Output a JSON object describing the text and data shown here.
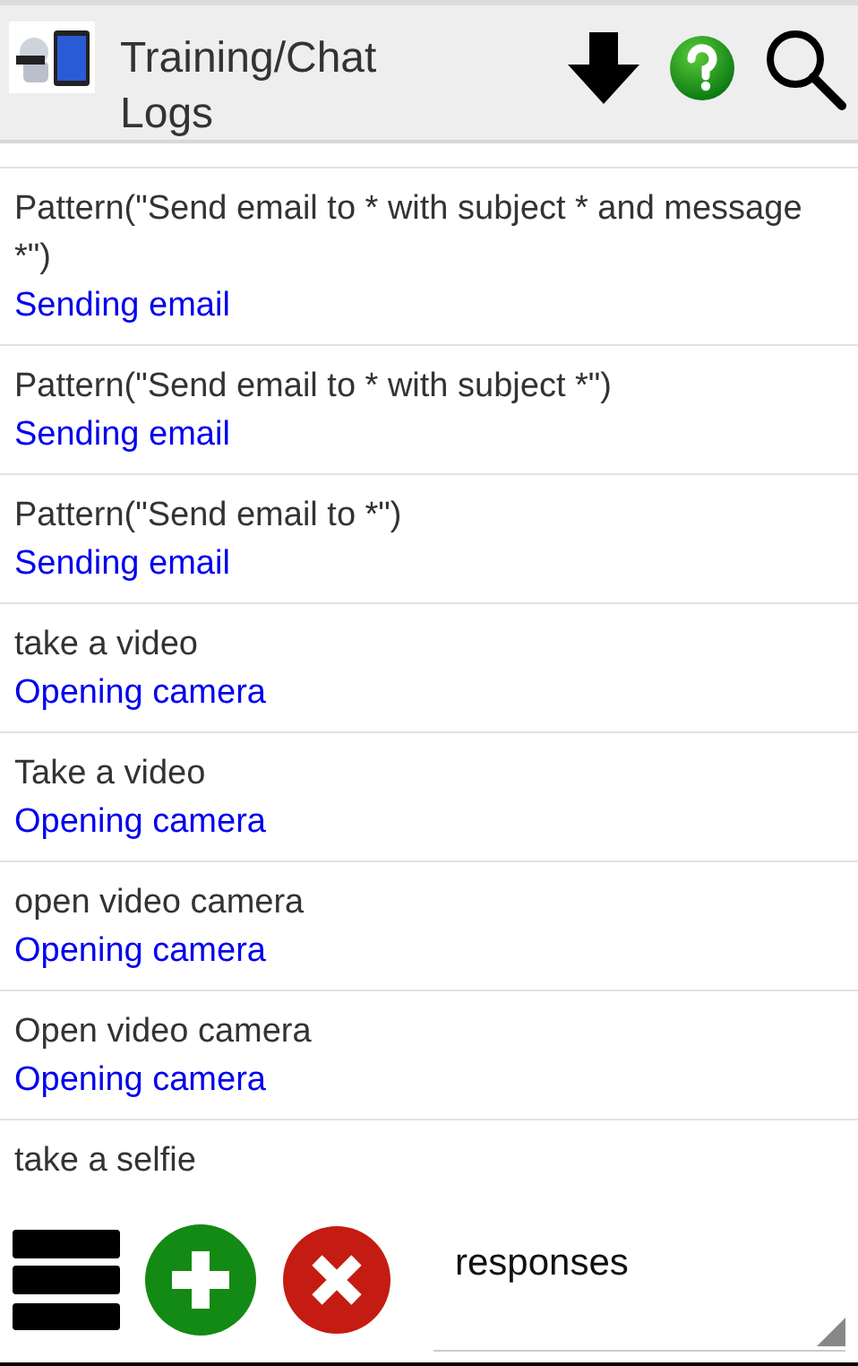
{
  "header": {
    "title": "Training/Chat Logs"
  },
  "logs": [
    {
      "input": "Pattern(\"Send email to * with subject * and message *\")",
      "response": "Sending email"
    },
    {
      "input": "Pattern(\"Send email to * with subject *\")",
      "response": "Sending email"
    },
    {
      "input": "Pattern(\"Send email to *\")",
      "response": "Sending email"
    },
    {
      "input": "take a video",
      "response": "Opening camera"
    },
    {
      "input": "Take a video",
      "response": "Opening camera"
    },
    {
      "input": "open video camera",
      "response": "Opening camera"
    },
    {
      "input": "Open video camera",
      "response": "Opening camera"
    },
    {
      "input": "take a selfie"
    }
  ],
  "footer": {
    "filter": {
      "value": "responses"
    }
  }
}
